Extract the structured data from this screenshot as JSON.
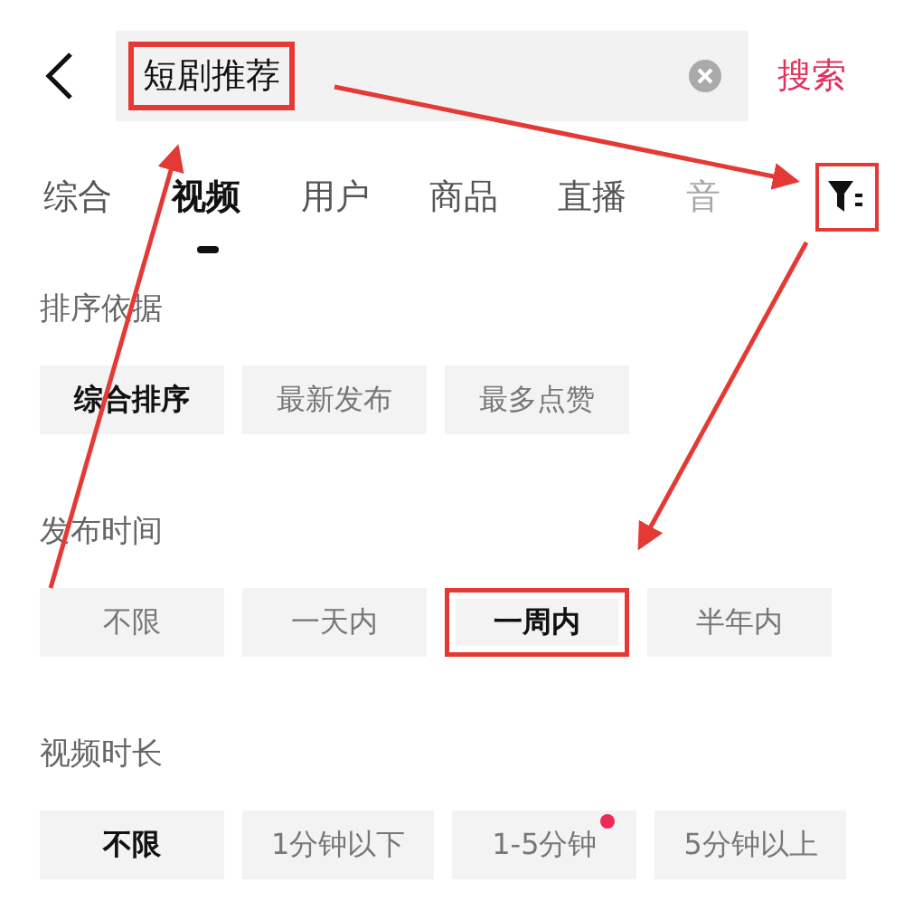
{
  "search": {
    "value": "短剧推荐",
    "highlighted": true,
    "button": "搜索"
  },
  "tabs": [
    {
      "label": "综合",
      "selected": false,
      "faded": false
    },
    {
      "label": "视频",
      "selected": true,
      "faded": false
    },
    {
      "label": "用户",
      "selected": false,
      "faded": false
    },
    {
      "label": "商品",
      "selected": false,
      "faded": false
    },
    {
      "label": "直播",
      "selected": false,
      "faded": false
    },
    {
      "label": "音",
      "selected": false,
      "faded": true
    }
  ],
  "filter": {
    "highlighted": true
  },
  "sections": [
    {
      "title": "排序依据",
      "options": [
        {
          "label": "综合排序",
          "selected": true,
          "highlighted": false,
          "dot": false
        },
        {
          "label": "最新发布",
          "selected": false,
          "highlighted": false,
          "dot": false
        },
        {
          "label": "最多点赞",
          "selected": false,
          "highlighted": false,
          "dot": false
        }
      ]
    },
    {
      "title": "发布时间",
      "options": [
        {
          "label": "不限",
          "selected": false,
          "highlighted": false,
          "dot": false
        },
        {
          "label": "一天内",
          "selected": false,
          "highlighted": false,
          "dot": false
        },
        {
          "label": "一周内",
          "selected": true,
          "highlighted": true,
          "dot": false
        },
        {
          "label": "半年内",
          "selected": false,
          "highlighted": false,
          "dot": false
        }
      ]
    },
    {
      "title": "视频时长",
      "options": [
        {
          "label": "不限",
          "selected": true,
          "highlighted": false,
          "dot": false
        },
        {
          "label": "1分钟以下",
          "selected": false,
          "highlighted": false,
          "dot": false
        },
        {
          "label": "1-5分钟",
          "selected": false,
          "highlighted": false,
          "dot": true
        },
        {
          "label": "5分钟以上",
          "selected": false,
          "highlighted": false,
          "dot": false
        }
      ]
    }
  ]
}
